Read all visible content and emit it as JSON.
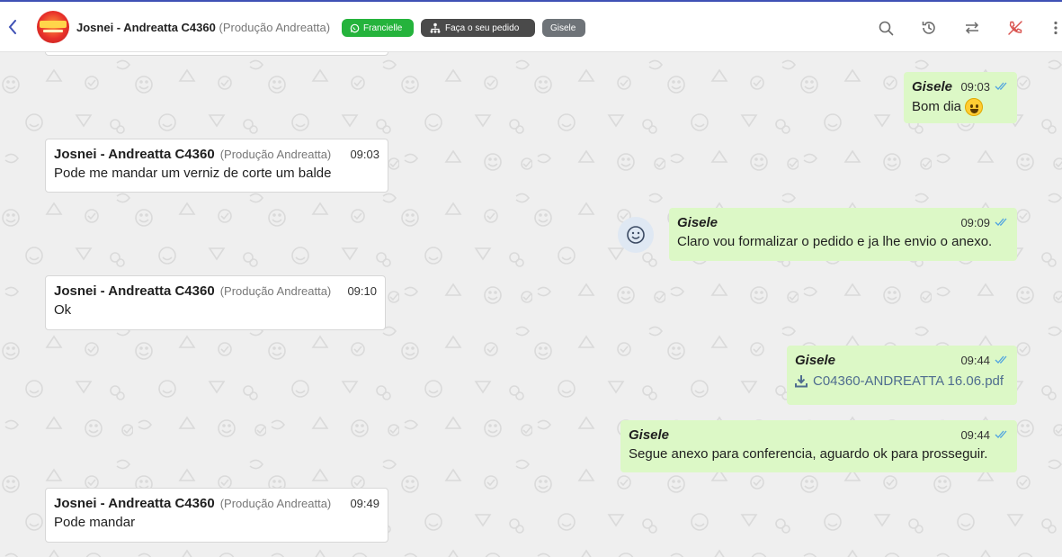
{
  "header": {
    "contact_name": "Josnei - Andreatta C4360",
    "contact_sub": "(Produção Andreatta)",
    "tags": {
      "whatsapp_agent": "Francielle",
      "order": "Faça o seu pedido",
      "user": "Gisele"
    },
    "colors": {
      "accent": "#3f51b5",
      "tag_green": "#25b33c",
      "call_end": "#d9534f"
    }
  },
  "messages": [
    {
      "sender": "Gisele",
      "time": "09:03",
      "text": "Bom dia",
      "emoji": "grinning-face"
    },
    {
      "sender": "Josnei - Andreatta C4360",
      "sub": "(Produção Andreatta)",
      "time": "09:03",
      "text": "Pode me mandar um verniz de corte um balde"
    },
    {
      "sender": "Gisele",
      "time": "09:09",
      "text": "Claro vou formalizar o pedido e ja lhe envio o anexo."
    },
    {
      "sender": "Josnei - Andreatta C4360",
      "sub": "(Produção Andreatta)",
      "time": "09:10",
      "text": "Ok"
    },
    {
      "sender": "Gisele",
      "time": "09:44",
      "file": "C04360-ANDREATTA 16.06.pdf"
    },
    {
      "sender": "Gisele",
      "time": "09:44",
      "text": "Segue anexo para conferencia, aguardo ok para prosseguir."
    },
    {
      "sender": "Josnei - Andreatta C4360",
      "sub": "(Produção Andreatta)",
      "time": "09:49",
      "text": "Pode mandar"
    }
  ]
}
